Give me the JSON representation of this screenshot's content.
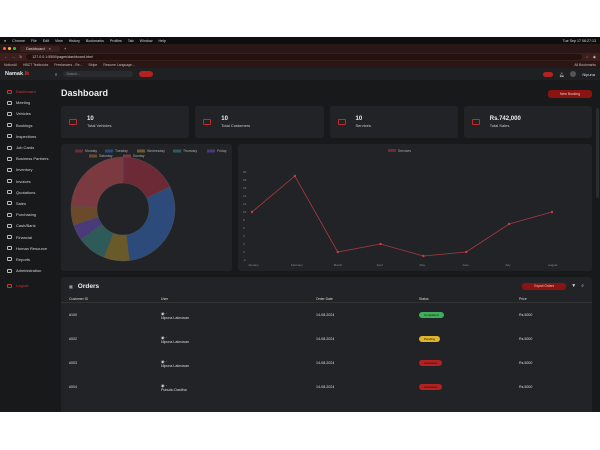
{
  "macos": {
    "apple": "",
    "menus": [
      "Chrome",
      "File",
      "Edit",
      "View",
      "History",
      "Bookmarks",
      "Profiles",
      "Tab",
      "Window",
      "Help"
    ],
    "clock": "Tue Sep 17  08:27:13"
  },
  "browser": {
    "tab_title": "Dashboard",
    "url": "127.0.0.1:5500/pages/dashboard.html",
    "bookmarks": [
      "NotionAI",
      "HBCT Textbooks",
      "Freelancers - Re...",
      "Stripe",
      "Resume Language..."
    ],
    "all_bookmarks": "All Bookmarks"
  },
  "app": {
    "logo_main": "Namak",
    "search_placeholder": "Search...",
    "user_name": "Nipuna"
  },
  "sidebar": {
    "items": [
      {
        "label": "Dashboard",
        "icon": "home-icon"
      },
      {
        "label": "Meeting",
        "icon": "calendar-icon"
      },
      {
        "label": "Vehicles",
        "icon": "car-icon"
      },
      {
        "label": "Bookings",
        "icon": "book-icon"
      },
      {
        "label": "Inspections",
        "icon": "clipboard-icon"
      },
      {
        "label": "Job Cards",
        "icon": "card-icon"
      },
      {
        "label": "Business Partners",
        "icon": "handshake-icon"
      },
      {
        "label": "Inventory",
        "icon": "box-icon"
      },
      {
        "label": "Invoices",
        "icon": "invoice-icon"
      },
      {
        "label": "Quotations",
        "icon": "quote-icon"
      },
      {
        "label": "Sales",
        "icon": "tag-icon"
      },
      {
        "label": "Purchasing",
        "icon": "cart-icon"
      },
      {
        "label": "Cash/Bank",
        "icon": "bank-icon"
      },
      {
        "label": "Financial",
        "icon": "chart-icon"
      },
      {
        "label": "Human Resource",
        "icon": "people-icon"
      },
      {
        "label": "Reports",
        "icon": "report-icon"
      },
      {
        "label": "Administration",
        "icon": "gear-icon"
      }
    ],
    "logout": "Logout"
  },
  "page": {
    "title": "Dashboard",
    "new_button": "New Booking"
  },
  "stats": [
    {
      "value": "10",
      "label": "Total Vehicles",
      "icon": "car-icon"
    },
    {
      "value": "10",
      "label": "Total Customers",
      "icon": "user-icon"
    },
    {
      "value": "10",
      "label": "Services",
      "icon": "wrench-icon"
    },
    {
      "value": "Rs.742,000",
      "label": "Total Sales",
      "icon": "money-icon"
    }
  ],
  "colors": {
    "accent": "#d2312f",
    "panel": "#222326",
    "bg": "#18191b"
  },
  "chart_data": [
    {
      "type": "pie",
      "title": "",
      "categories": [
        "Monday",
        "Tuesday",
        "Wednesday",
        "Thursday",
        "Friday",
        "Saturday",
        "Sunday"
      ],
      "values": [
        18,
        30,
        8,
        9,
        5,
        6,
        24
      ],
      "colors": [
        "#6b2a35",
        "#2c4a7a",
        "#6a5a2a",
        "#2f5a5a",
        "#4a3a7a",
        "#6a4a2a",
        "#7a3a40"
      ],
      "legend": "top"
    },
    {
      "type": "line",
      "title": "",
      "series": [
        {
          "name": "Services",
          "values": [
            10,
            19,
            0,
            2,
            -1,
            0,
            7,
            10
          ]
        }
      ],
      "categories": [
        "January",
        "February",
        "March",
        "April",
        "May",
        "June",
        "July",
        "August"
      ],
      "ylim": [
        -2,
        24
      ],
      "yticks": [
        "20",
        "18",
        "16",
        "14",
        "12",
        "10",
        "8",
        "6",
        "4",
        "2",
        "0",
        "-2"
      ],
      "grid": false,
      "legend": "top"
    }
  ],
  "orders": {
    "title": "Orders",
    "export_label": "Export Orders",
    "columns": [
      "Customer ID",
      "User",
      "Order Date",
      "Status",
      "Price"
    ],
    "rows": [
      {
        "id": "#100",
        "user": "Nipuna Lakruwan",
        "date": "14-08-2024",
        "status": "Completed",
        "status_color": "#3fae5a",
        "price": "Rs.5000"
      },
      {
        "id": "#002",
        "user": "Nipuna Lakruwan",
        "date": "14-08-2024",
        "status": "Pending",
        "status_color": "#e0b52c",
        "price": "Rs.5000"
      },
      {
        "id": "#003",
        "user": "Nipuna Lakruwan",
        "date": "14-08-2024",
        "status": "Canceled",
        "status_color": "#b5211f",
        "price": "Rs.5000"
      },
      {
        "id": "#004",
        "user": "Pubudu Dasitha",
        "date": "14-08-2024",
        "status": "Canceled",
        "status_color": "#b5211f",
        "price": "Rs.5000"
      }
    ]
  }
}
